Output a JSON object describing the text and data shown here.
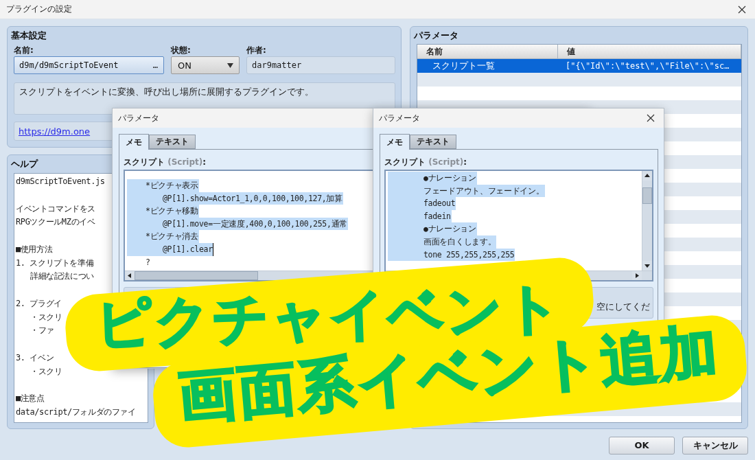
{
  "window": {
    "title": "プラグインの設定"
  },
  "basic_settings": {
    "title": "基本設定",
    "name": {
      "label": "名前:",
      "value": "d9m/d9mScriptToEvent",
      "button": "…"
    },
    "status": {
      "label": "状態:",
      "value": "ON"
    },
    "author": {
      "label": "作者:",
      "value": "dar9matter"
    },
    "description": "スクリプトをイベントに変換、呼び出し場所に展開するプラグインです。",
    "url": "https://d9m.one"
  },
  "help": {
    "title": "ヘルプ",
    "blocks": [
      {
        "lines": [
          {
            "text": "d9mScriptToEvent.js"
          }
        ]
      },
      {
        "lines": [
          {
            "text": "イベントコマンドをス"
          },
          {
            "text": "RPGツクールMZのイベ"
          }
        ]
      },
      {
        "lines": [
          {
            "text": "■使用方法"
          },
          {
            "text": "1. スクリプトを準備",
            "children": [
              {
                "text": "詳細な記法につい"
              }
            ]
          }
        ]
      },
      {
        "lines": [
          {
            "text": "2. プラグイ",
            "children": [
              {
                "text": "・スクリ"
              },
              {
                "text": "・ファ"
              }
            ]
          }
        ]
      },
      {
        "lines": [
          {
            "text": "3. イベン",
            "children": [
              {
                "text": "・スクリ"
              }
            ]
          }
        ]
      },
      {
        "lines": [
          {
            "text": "■注意点"
          },
          {
            "text": "data/script/フォルダのファイ"
          }
        ]
      }
    ]
  },
  "parameters": {
    "title": "パラメータ",
    "columns": [
      "名前",
      "値"
    ],
    "rows": [
      {
        "name": "スクリプト一覧",
        "value": "[\"{\\\"Id\\\":\\\"test\\\",\\\"File\\\":\\\"sc…",
        "selected": true
      }
    ]
  },
  "dialogs": [
    {
      "title": "パラメータ",
      "tabs": [
        {
          "label": "メモ",
          "selected": true
        },
        {
          "label": "テキスト",
          "selected": false
        }
      ],
      "script": {
        "label": "スクリプト",
        "hint": "(Script)",
        "suffix": ":",
        "lines": [
          {
            "text": "*ピクチャ表示",
            "selected": true,
            "children": [
              {
                "text": "@P[1].show=Actor1_1,0,0,100,100,127,加算",
                "selected": true
              }
            ]
          },
          {
            "text": "*ピクチャ移動",
            "selected": true,
            "children": [
              {
                "text": "@P[1].move=一定速度,400,0,100,100,255,通常",
                "selected": true
              }
            ]
          },
          {
            "text": "*ピクチャ消去",
            "selected": true,
            "children": [
              {
                "text": "@P[1].clear",
                "selected": true,
                "caret": true
              }
            ]
          },
          {
            "text": "?",
            "selected": false
          }
        ]
      }
    },
    {
      "title": "パラメータ",
      "tabs": [
        {
          "label": "メモ",
          "selected": true
        },
        {
          "label": "テキスト",
          "selected": false
        }
      ],
      "script": {
        "label": "スクリプト",
        "hint": "(Script)",
        "suffix": ":",
        "lines": [
          {
            "text": "●ナレーション",
            "selected": true
          },
          {
            "text": "フェードアウト、フェードイン。",
            "selected": true
          },
          {
            "text": "fadeout",
            "selected": true
          },
          {
            "text": "fadein",
            "selected": true
          },
          {
            "text": "●ナレーション",
            "selected": true
          },
          {
            "text": "画面を白くします。",
            "selected": true
          },
          {
            "text": "tone 255,255,255,255",
            "selected": true
          }
        ]
      },
      "description": "空にしてくだ"
    }
  ],
  "buttons": [
    "OK",
    "キャンセル"
  ],
  "banner": {
    "lines": [
      "ピクチャイベント",
      "画面系イベント追加"
    ]
  }
}
